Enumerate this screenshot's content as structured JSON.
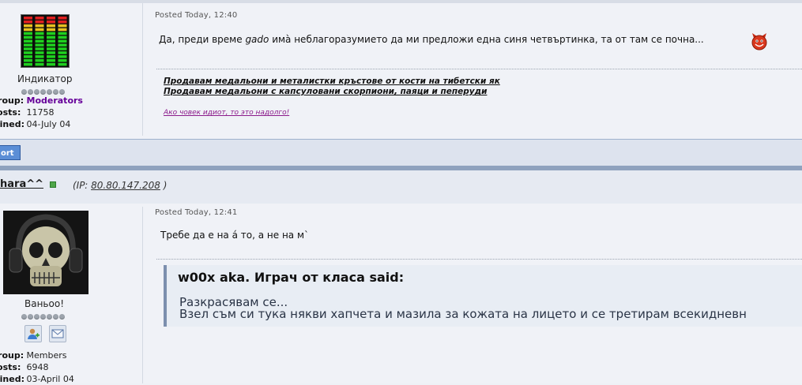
{
  "post1": {
    "user_title": "Индикатор",
    "info": [
      {
        "key": "Group:",
        "value": "Moderators"
      },
      {
        "key": "Posts:",
        "value": "11758"
      },
      {
        "key": "Joined:",
        "value": "04-July 04"
      }
    ],
    "posted": "Posted Today, 12:40",
    "text_before": "Да, преди време ",
    "text_italic": "gado",
    "text_after": " имà неблагоразумието да ми предложи една синя четвъртинка, та от там се почна...",
    "emoticon": "devil-icon",
    "sig_links": [
      "Продавам медальони и металистки кръстове от кости на тибетски як",
      "Продавам медальони с капсуловани скорпиони, паяци и пеперуди"
    ],
    "sig_motto": "Ако човек идиот, то это надолго!"
  },
  "report_label": "ort",
  "post2": {
    "username": "hara^^",
    "ip_label": "(IP: ",
    "ip": "80.80.147.208",
    "ip_close": " )",
    "user_title": "Ваньоо!",
    "info": [
      {
        "key": "Group:",
        "value": "Members"
      },
      {
        "key": "Posts:",
        "value": "6948"
      },
      {
        "key": "Joined:",
        "value": "03-April 04"
      }
    ],
    "posted": "Posted Today, 12:41",
    "text": "Требе да е на á то, а не на м`",
    "quote": {
      "head": "w00x aka. Играч от класа said:",
      "line1": "Разкрасявам се...",
      "line2": "Взел съм си тука някви хапчета и мазила за кожата на лицето и се третирам всекидневн"
    }
  },
  "colors": {
    "moderator": "#660099",
    "report_button": "#5b8ed6",
    "divider": "#8fa2be",
    "signature_motto": "#8b1a8b"
  }
}
